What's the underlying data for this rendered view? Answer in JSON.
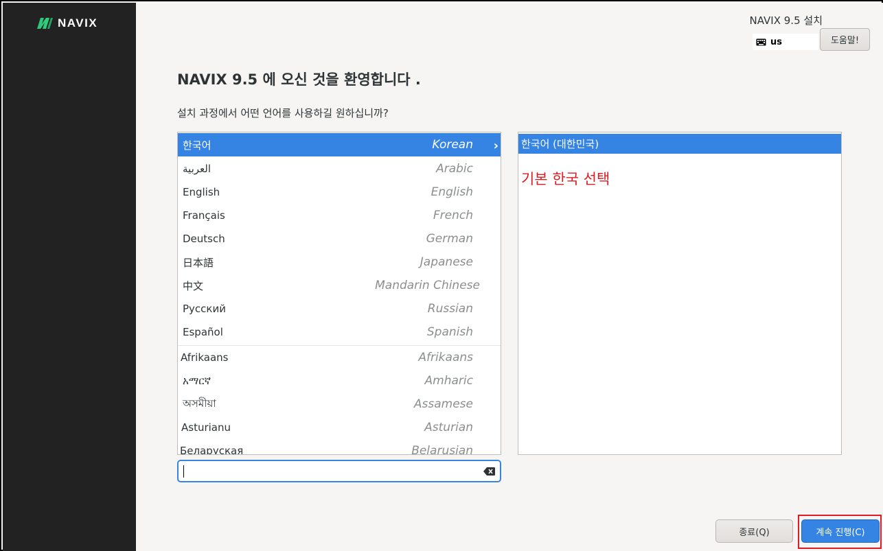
{
  "sidebar": {
    "logo_text": "NAVIX",
    "logo_icon": "navix-logo-icon"
  },
  "header": {
    "product_title": "NAVIX 9.5 설치",
    "keyboard_layout": "us",
    "keyboard_icon": "keyboard-icon",
    "help_label": "도움말!"
  },
  "main": {
    "welcome_title": "NAVIX 9.5 에 오신 것을 환영합니다 .",
    "question": "설치 과정에서 어떤 언어를 사용하길 원하십니까?"
  },
  "languages": [
    {
      "native": "한국어",
      "english": "Korean",
      "selected": true
    },
    {
      "native": "العربية",
      "english": "Arabic"
    },
    {
      "native": "English",
      "english": "English"
    },
    {
      "native": "Français",
      "english": "French"
    },
    {
      "native": "Deutsch",
      "english": "German"
    },
    {
      "native": "日本語",
      "english": "Japanese"
    },
    {
      "native": "中文",
      "english": "Mandarin Chinese"
    },
    {
      "native": "Русский",
      "english": "Russian"
    },
    {
      "native": "Español",
      "english": "Spanish"
    },
    {
      "native": "Afrikaans",
      "english": "Afrikaans"
    },
    {
      "native": "አማርኛ",
      "english": "Amharic"
    },
    {
      "native": "অসমীয়া",
      "english": "Assamese"
    },
    {
      "native": "Asturianu",
      "english": "Asturian"
    },
    {
      "native": "Беларуская",
      "english": "Belarusian"
    }
  ],
  "locales": [
    {
      "label": "한국어 (대한민국)",
      "selected": true
    }
  ],
  "annotation": "기본 한국 선택",
  "search": {
    "value": "",
    "clear_icon": "backspace-clear-icon"
  },
  "footer": {
    "quit_label": "종료(Q)",
    "continue_label": "계속 진행(C)"
  },
  "colors": {
    "accent": "#3584e4",
    "annotation": "#e01b24",
    "sidebar": "#222222",
    "logo_accent": "#2ec27e"
  }
}
